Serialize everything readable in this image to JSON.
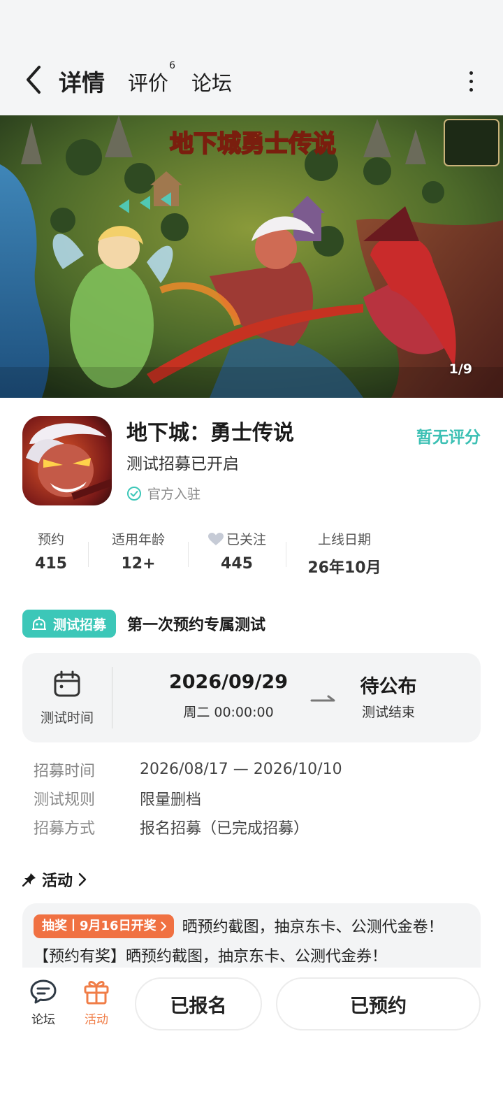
{
  "header": {
    "tabs": [
      {
        "label": "详情",
        "active": true
      },
      {
        "label": "评价",
        "badge": "6"
      },
      {
        "label": "论坛"
      }
    ]
  },
  "banner": {
    "counter": "1/9",
    "logo_text": "地下城勇士传说"
  },
  "game": {
    "title": "地下城：勇士传说",
    "subtitle": "测试招募已开启",
    "official": "官方入驻",
    "rating": "暂无评分"
  },
  "stats": [
    {
      "label": "预约",
      "value": "415"
    },
    {
      "label": "适用年龄",
      "value": "12+"
    },
    {
      "label": "已关注",
      "value": "445"
    },
    {
      "label": "上线日期",
      "value": "26年10月"
    }
  ],
  "test": {
    "badge": "测试招募",
    "title": "第一次预约专属测试",
    "time_label": "测试时间",
    "start_date": "2026/09/29",
    "start_time": "周二  00:00:00",
    "end_date": "待公布",
    "end_label": "测试结束",
    "info": [
      {
        "key": "招募时间",
        "value": "2026/08/17 — 2026/10/10"
      },
      {
        "key": "测试规则",
        "value": "限量删档"
      },
      {
        "key": "招募方式",
        "value": "报名招募（已完成招募）"
      }
    ]
  },
  "activity": {
    "header": "活动",
    "tag": "抽奖丨9月16日开奖",
    "text": "晒预约截图，抽京东卡、公测代金卷！【预约有奖】晒预约截图，抽京东卡、公测代金券！"
  },
  "bottom": {
    "forum_label": "论坛",
    "activity_label": "活动",
    "signed_label": "已报名",
    "reserved_label": "已预约"
  },
  "colors": {
    "accent": "#3cc7b8",
    "orange": "#f07142",
    "card_bg": "#f3f4f5"
  }
}
